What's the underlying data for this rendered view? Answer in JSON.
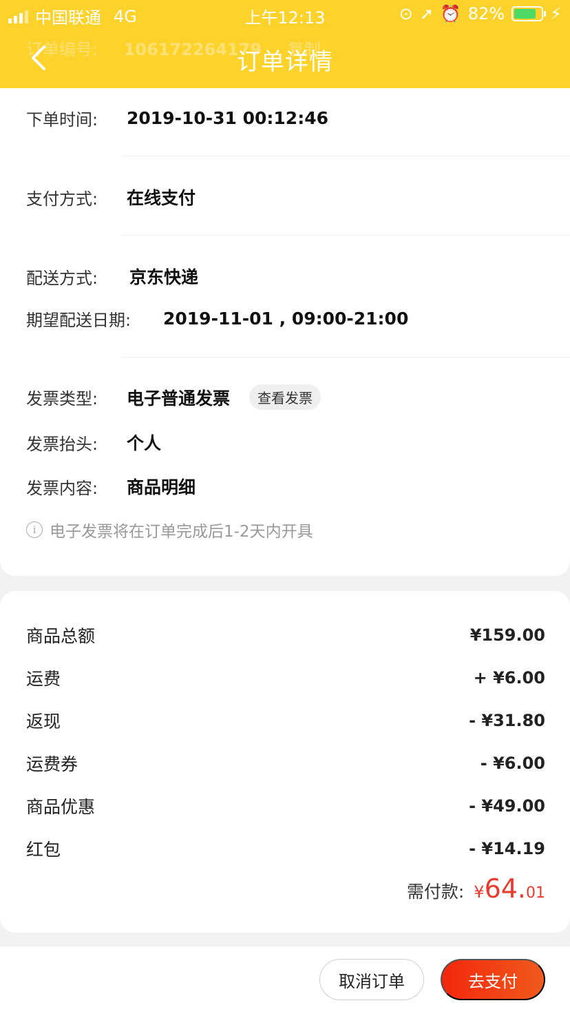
{
  "status_bar": {
    "carrier": "中国联通",
    "network": "4G",
    "time": "上午12:13",
    "battery_percent": "82%",
    "battery_level": 0.82
  },
  "nav": {
    "title": "订单详情"
  },
  "ghost_row": {
    "label": "订单编号:",
    "value": "106172264179",
    "action": "复制"
  },
  "order_info": {
    "order_time_label": "下单时间:",
    "order_time": "2019-10-31 00:12:46",
    "payment_label": "支付方式:",
    "payment": "在线支付",
    "delivery_label": "配送方式:",
    "delivery": "京东快递",
    "expected_label": "期望配送日期:",
    "expected": "2019-11-01 , 09:00-21:00",
    "invoice_type_label": "发票类型:",
    "invoice_type": "电子普通发票",
    "view_invoice": "查看发票",
    "invoice_title_label": "发票抬头:",
    "invoice_title": "个人",
    "invoice_content_label": "发票内容:",
    "invoice_content": "商品明细",
    "note": "电子发票将在订单完成后1-2天内开具"
  },
  "price": {
    "rows": [
      {
        "label": "商品总额",
        "value": "¥159.00"
      },
      {
        "label": "运费",
        "value": "+ ¥6.00"
      },
      {
        "label": "返现",
        "value": "- ¥31.80"
      },
      {
        "label": "运费券",
        "value": "- ¥6.00"
      },
      {
        "label": "商品优惠",
        "value": "- ¥49.00"
      },
      {
        "label": "红包",
        "value": "- ¥14.19"
      }
    ],
    "total_label": "需付款:",
    "total_currency": "¥",
    "total_int": "64.",
    "total_dec": "01"
  },
  "actions": {
    "cancel": "取消订单",
    "pay": "去支付"
  },
  "colors": {
    "brand_yellow": "#fdd22a",
    "price_red": "#e93b2e",
    "pay_button": "#f2270c"
  }
}
